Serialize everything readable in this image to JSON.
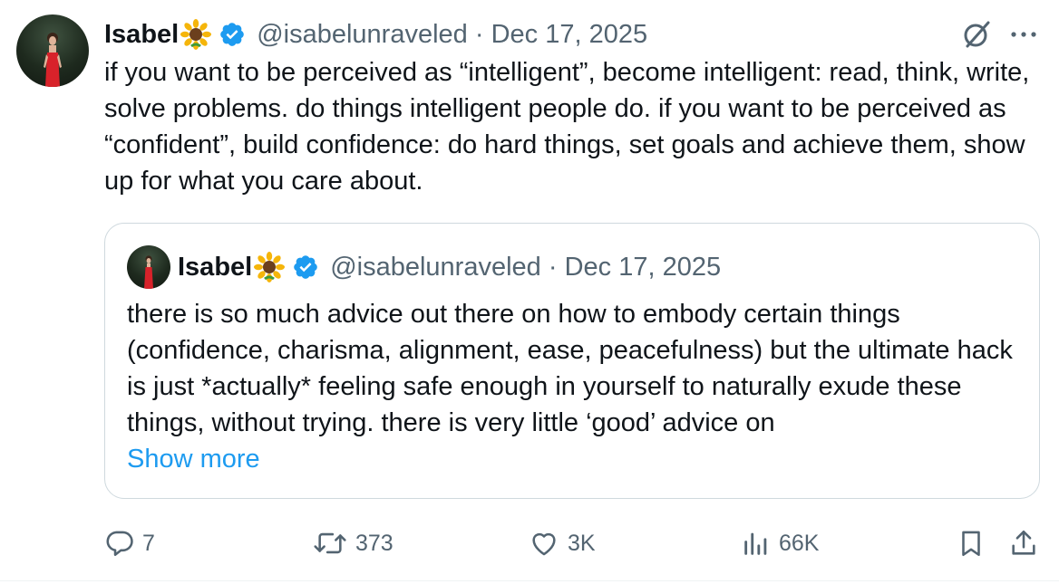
{
  "author": {
    "name": "Isabel",
    "handle": "@isabelunraveled",
    "date": "Dec 17, 2025",
    "verified": true
  },
  "tweet": {
    "text": "if you want to be perceived as “intelligent”, become intelligent: read, think, write, solve problems. do things intelligent people do. if you want to be perceived as “confident”, build confidence: do hard things, set goals and achieve them, show up for what you care about."
  },
  "quoted": {
    "name": "Isabel",
    "handle": "@isabelunraveled",
    "date": "Dec 17, 2025",
    "text": "there is so much advice out there on how to embody certain things (confidence, charisma, alignment, ease, peacefulness) but the ultimate hack is just *actually* feeling safe enough in yourself to naturally exude these things, without trying. there is very little ‘good’ advice on",
    "show_more": "Show more"
  },
  "actions": {
    "replies": "7",
    "reposts": "373",
    "likes": "3K",
    "views": "66K"
  },
  "icons": {
    "reply": "reply-icon",
    "repost": "repost-icon",
    "like": "heart-icon",
    "views": "analytics-icon",
    "bookmark": "bookmark-icon",
    "share": "share-icon",
    "grok": "grok-icon",
    "more": "more-icon",
    "verified": "verified-badge-icon",
    "emoji": "sunflower-emoji-icon"
  },
  "colors": {
    "text": "#0f1419",
    "secondary": "#536471",
    "link": "#1d9bf0",
    "verified": "#1d9bf0",
    "border": "#cfd9de"
  }
}
